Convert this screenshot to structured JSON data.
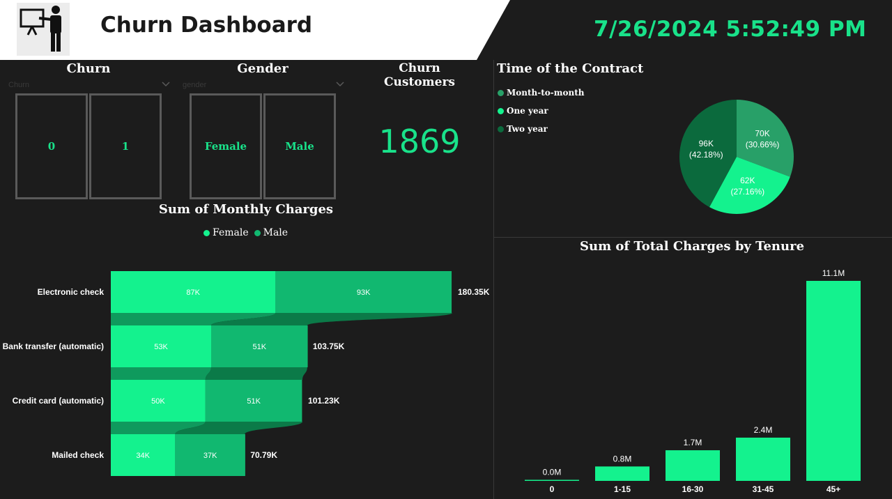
{
  "header": {
    "title": "Churn Dashboard",
    "datetime": "7/26/2024 5:52:49 PM",
    "logo_icon": "presenter-icon"
  },
  "slicers": {
    "churn": {
      "title": "Churn",
      "field": "Churn",
      "options": [
        "0",
        "1"
      ]
    },
    "gender": {
      "title": "Gender",
      "field": "gender",
      "options": [
        "Female",
        "Male"
      ]
    }
  },
  "kpi": {
    "title": "Churn Customers",
    "value": "1869"
  },
  "contract_chart_title": "Time of the Contract",
  "monthly_chart_title": "Sum of Monthly Charges",
  "tenure_chart_title": "Sum of Total Charges by Tenure",
  "colors": {
    "background": "#1c1c1c",
    "accent": "#19e28a",
    "bar_light": "#14f28e",
    "bar_dark": "#11b870",
    "pie_month": "#28a068",
    "pie_one": "#14f28e",
    "pie_two": "#0b6a3d"
  },
  "chart_data": [
    {
      "type": "pie",
      "title": "Time of the Contract",
      "legend_position": "top-left",
      "categories": [
        "Month-to-month",
        "One year",
        "Two year"
      ],
      "values": [
        70,
        62,
        96
      ],
      "labels": [
        "70K",
        "62K",
        "96K"
      ],
      "percents": [
        "(30.66%)",
        "(27.16%)",
        "(42.18%)"
      ],
      "colors": [
        "#28a068",
        "#14f28e",
        "#0b6a3d"
      ]
    },
    {
      "type": "bar",
      "orientation": "horizontal",
      "stacked": true,
      "title": "Sum of Monthly Charges",
      "legend_position": "top-center",
      "categories": [
        "Electronic check",
        "Bank transfer (automatic)",
        "Credit card (automatic)",
        "Mailed check"
      ],
      "series": [
        {
          "name": "Female",
          "values": [
            87,
            53,
            50,
            34
          ],
          "labels": [
            "87K",
            "53K",
            "50K",
            "34K"
          ]
        },
        {
          "name": "Male",
          "values": [
            93,
            51,
            51,
            37
          ],
          "labels": [
            "93K",
            "51K",
            "51K",
            "37K"
          ]
        }
      ],
      "totals": [
        "180.35K",
        "103.75K",
        "101.23K",
        "70.79K"
      ],
      "total_values": [
        180.35,
        103.75,
        101.23,
        70.79
      ]
    },
    {
      "type": "bar",
      "title": "Sum of Total Charges by Tenure",
      "categories": [
        "0",
        "1-15",
        "16-30",
        "31-45",
        "45+"
      ],
      "values": [
        0.0,
        0.8,
        1.7,
        2.4,
        11.1
      ],
      "labels": [
        "0.0M",
        "0.8M",
        "1.7M",
        "2.4M",
        "11.1M"
      ]
    }
  ]
}
